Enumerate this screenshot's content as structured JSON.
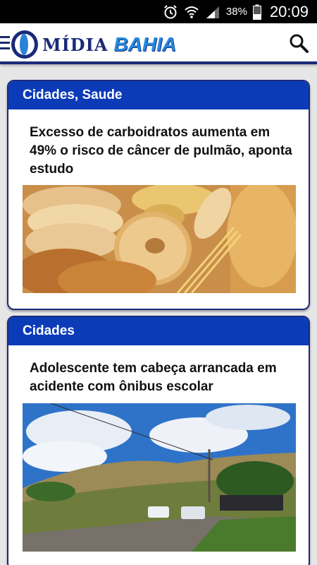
{
  "statusbar": {
    "battery_percent": "38%",
    "time": "20:09",
    "icons": [
      "alarm-icon",
      "wifi-icon",
      "signal-icon",
      "battery-icon"
    ]
  },
  "appbar": {
    "logo_part1": "MÍDIA",
    "logo_part2": "BAHIA",
    "icons": [
      "menu-icon",
      "search-icon"
    ]
  },
  "colors": {
    "header_blue": "#0c3bb8",
    "dark_navy": "#1b2a78",
    "logo_light_blue": "#2489df"
  },
  "articles": [
    {
      "category": "Cidades, Saude",
      "title": "Excesso de carboidratos aumenta em 49% o risco de câncer de pulmão, aponta estudo"
    },
    {
      "category": "Cidades",
      "title": "Adolescente tem cabeça arrancada em acidente com ônibus escolar"
    }
  ]
}
